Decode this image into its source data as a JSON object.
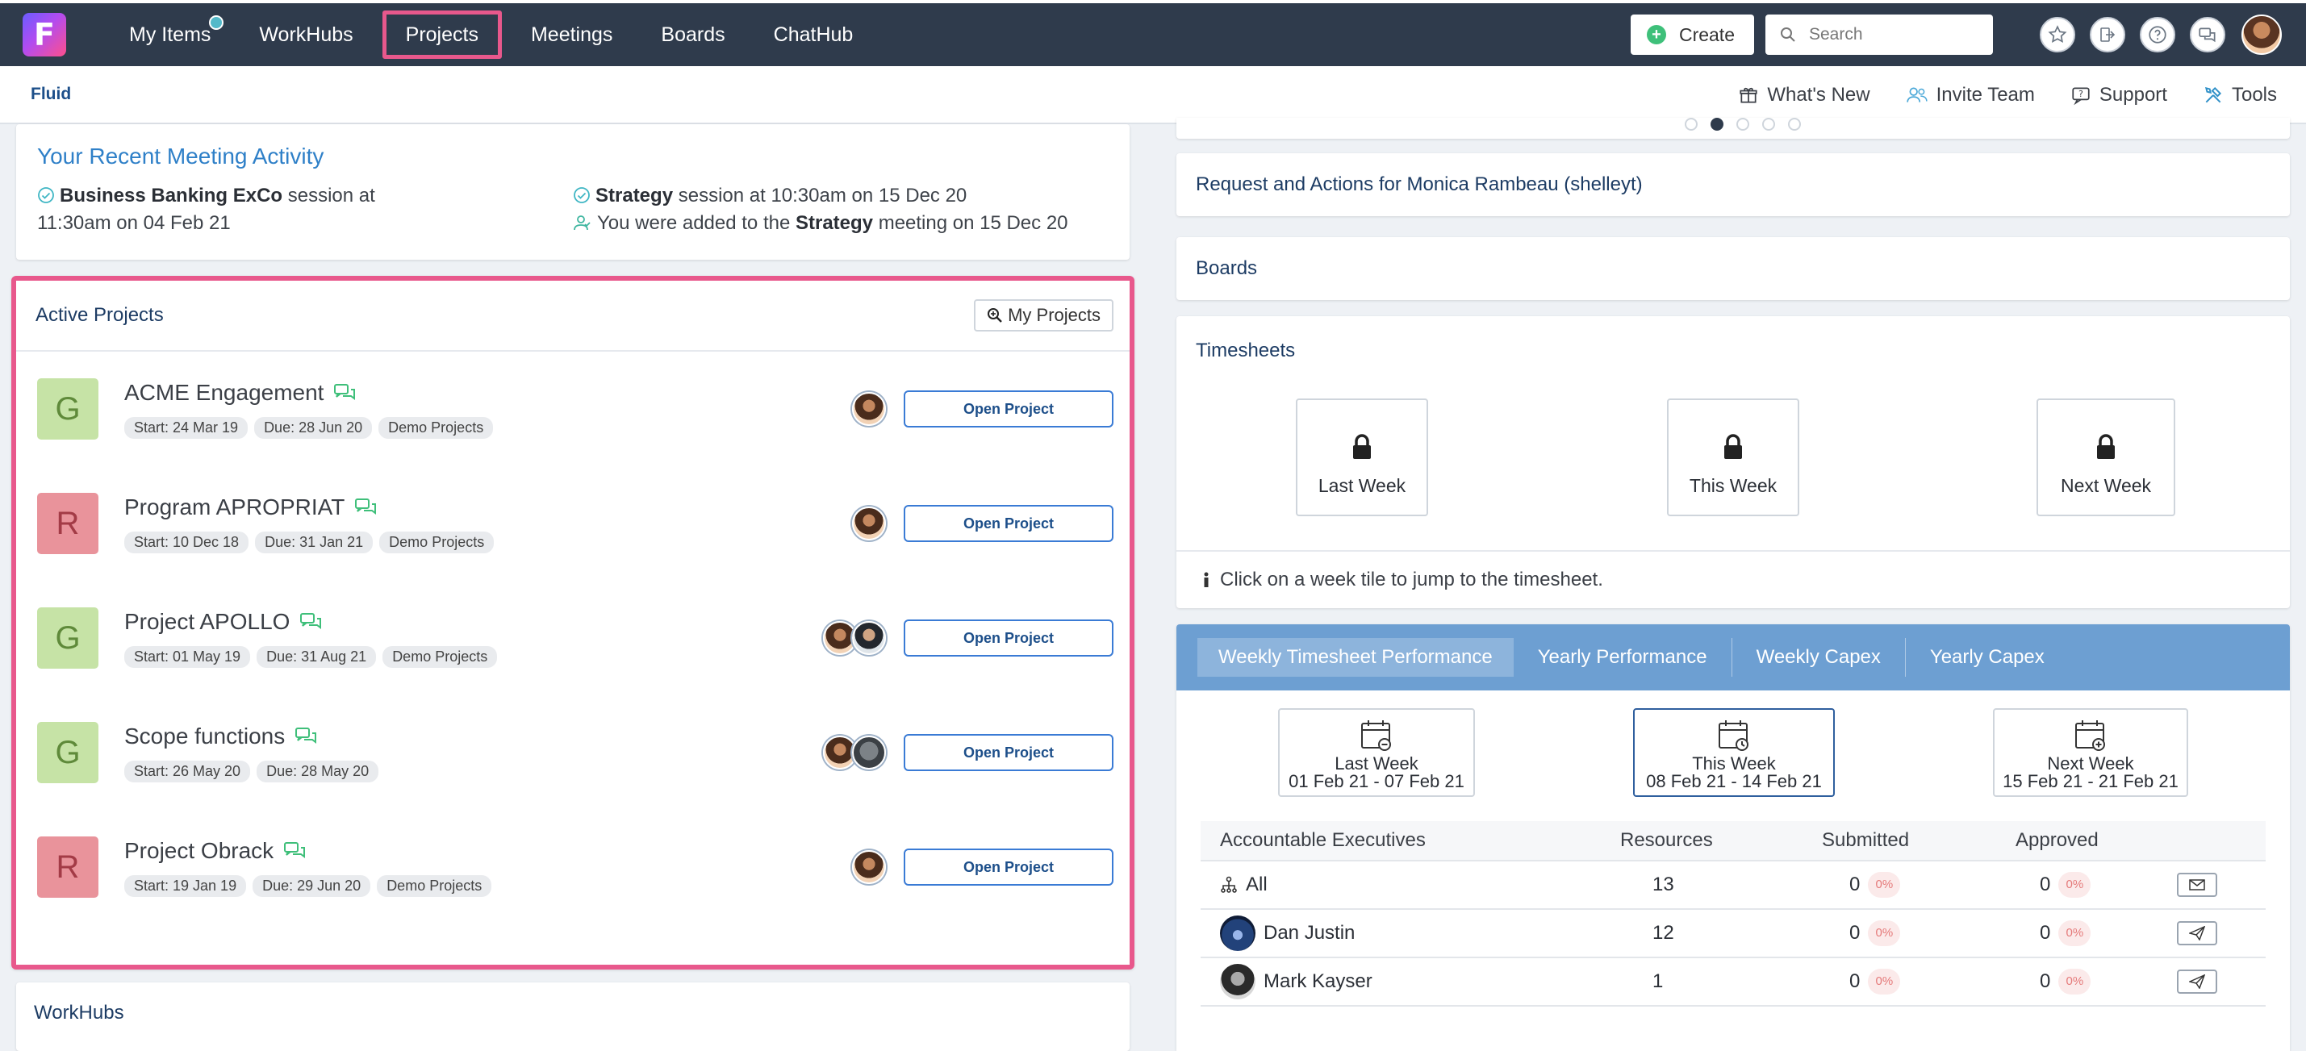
{
  "nav": {
    "logo_letter": "F",
    "items": [
      {
        "label": "My Items",
        "has_dot": true
      },
      {
        "label": "WorkHubs"
      },
      {
        "label": "Projects",
        "active": true
      },
      {
        "label": "Meetings"
      },
      {
        "label": "Boards"
      },
      {
        "label": "ChatHub"
      }
    ],
    "create_label": "Create",
    "search_placeholder": "Search"
  },
  "subnav": {
    "brand": "Fluid",
    "links": [
      {
        "label": "What's New",
        "icon": "gift-icon"
      },
      {
        "label": "Invite Team",
        "icon": "users-icon"
      },
      {
        "label": "Support",
        "icon": "support-icon"
      },
      {
        "label": "Tools",
        "icon": "tools-icon"
      }
    ]
  },
  "recent": {
    "title": "Your Recent Meeting Activity",
    "left": {
      "bold": "Business Banking ExCo",
      "text1": " session at",
      "text2": "11:30am on 04 Feb 21"
    },
    "right1": {
      "bold": "Strategy",
      "text": " session at 10:30am on 15 Dec 20"
    },
    "right2": {
      "text": "You were added to the ",
      "bold": "Strategy",
      "text2": " meeting on 15 Dec 20"
    }
  },
  "projects": {
    "title": "Active Projects",
    "my_projects_label": "My Projects",
    "open_label": "Open Project",
    "rows": [
      {
        "letter": "G",
        "color": "green",
        "name": "ACME Engagement",
        "start": "Start: 24 Mar 19",
        "due": "Due: 28 Jun 20",
        "group": "Demo Projects",
        "avatars": 1
      },
      {
        "letter": "R",
        "color": "red",
        "name": "Program APROPRIAT",
        "start": "Start: 10 Dec 18",
        "due": "Due: 31 Jan 21",
        "group": "Demo Projects",
        "avatars": 1
      },
      {
        "letter": "G",
        "color": "green",
        "name": "Project APOLLO",
        "start": "Start: 01 May 19",
        "due": "Due: 31 Aug 21",
        "group": "Demo Projects",
        "avatars": 2
      },
      {
        "letter": "G",
        "color": "green",
        "name": "Scope functions",
        "start": "Start: 26 May 20",
        "due": "Due: 28 May 20",
        "group": "",
        "avatars": 2
      },
      {
        "letter": "R",
        "color": "red",
        "name": "Project Obrack",
        "start": "Start: 19 Jan 19",
        "due": "Due: 29 Jun 20",
        "group": "Demo Projects",
        "avatars": 1
      }
    ]
  },
  "workhubs": {
    "title": "WorkHubs"
  },
  "right": {
    "requests_title": "Request and Actions for Monica Rambeau (shelleyt)",
    "boards_title": "Boards",
    "timesheets": {
      "title": "Timesheets",
      "tiles": [
        "Last Week",
        "This Week",
        "Next Week"
      ],
      "hint": "Click on a week tile to jump to the timesheet."
    },
    "performance": {
      "tabs": [
        "Weekly Timesheet Performance",
        "Yearly Performance",
        "Weekly Capex",
        "Yearly Capex"
      ],
      "periods": [
        {
          "label": "Last Week",
          "range": "01 Feb 21 - 07 Feb 21"
        },
        {
          "label": "This Week",
          "range": "08 Feb 21 - 14 Feb 21"
        },
        {
          "label": "Next Week",
          "range": "15 Feb 21 - 21 Feb 21"
        }
      ],
      "headers": {
        "exec": "Accountable Executives",
        "res": "Resources",
        "sub": "Submitted",
        "app": "Approved"
      },
      "rows": [
        {
          "name": "All",
          "res": "13",
          "sub": "0",
          "sub_pct": "0%",
          "app": "0",
          "app_pct": "0%"
        },
        {
          "name": "Dan Justin",
          "res": "12",
          "sub": "0",
          "sub_pct": "0%",
          "app": "0",
          "app_pct": "0%"
        },
        {
          "name": "Mark Kayser",
          "res": "1",
          "sub": "0",
          "sub_pct": "0%",
          "app": "0",
          "app_pct": "0%"
        }
      ]
    }
  }
}
